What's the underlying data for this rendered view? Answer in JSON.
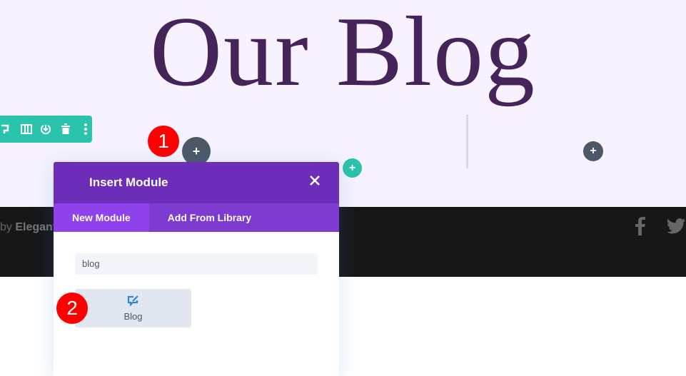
{
  "page": {
    "title": "Our Blog"
  },
  "footer": {
    "credit_prefix": "by",
    "credit_brand": "Elegant",
    "social": [
      "facebook-icon",
      "twitter-icon"
    ]
  },
  "toolbar": {
    "icons": [
      "duplicate-icon",
      "columns-icon",
      "save-icon",
      "trash-icon",
      "more-icon"
    ],
    "color": "#2ac3ab"
  },
  "markers": {
    "step1": "1",
    "step2": "2"
  },
  "modal": {
    "title": "Insert Module",
    "tabs": [
      {
        "label": "New Module",
        "active": true
      },
      {
        "label": "Add From Library",
        "active": false
      }
    ],
    "search": {
      "value": "blog"
    },
    "results": [
      {
        "label": "Blog",
        "icon": "blog-icon"
      }
    ],
    "header_color": "#6c2eb9"
  }
}
